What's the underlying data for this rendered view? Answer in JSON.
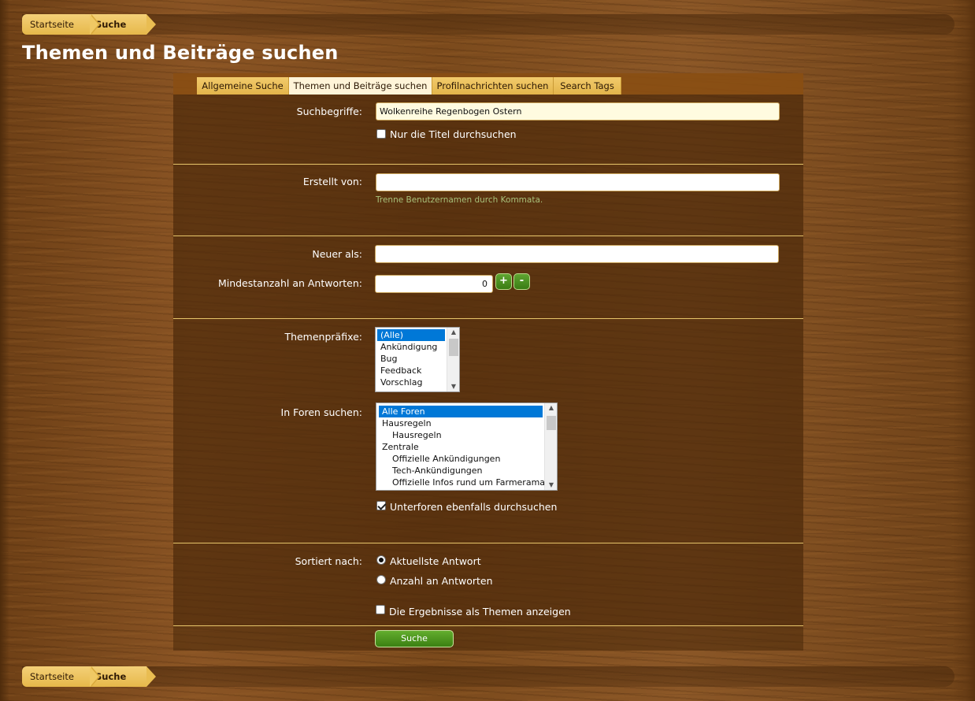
{
  "breadcrumb": {
    "home": "Startseite",
    "current": "Suche"
  },
  "page": {
    "title": "Themen und Beiträge suchen"
  },
  "tabs": [
    {
      "label": "Allgemeine Suche"
    },
    {
      "label": "Themen und Beiträge suchen"
    },
    {
      "label": "Profilnachrichten suchen"
    },
    {
      "label": "Search Tags"
    }
  ],
  "form": {
    "keywords_label": "Suchbegriffe:",
    "keywords_value": "Wolkenreihe Regenbogen Ostern",
    "titles_only_label": "Nur die Titel durchsuchen",
    "created_by_label": "Erstellt von:",
    "created_by_value": "",
    "created_by_hint": "Trenne Benutzernamen durch Kommata.",
    "newer_than_label": "Neuer als:",
    "newer_than_value": "",
    "min_replies_label": "Mindestanzahl an Antworten:",
    "min_replies_value": "0",
    "plus_label": "+",
    "minus_label": "-",
    "prefixes_label": "Themenpräfixe:",
    "prefixes": [
      "(Alle)",
      "Ankündigung",
      "Bug",
      "Feedback",
      "Vorschlag"
    ],
    "forums_label": "In Foren suchen:",
    "forums": [
      {
        "label": "Alle Foren",
        "indent": 0
      },
      {
        "label": "Hausregeln",
        "indent": 0
      },
      {
        "label": "Hausregeln",
        "indent": 1
      },
      {
        "label": "Zentrale",
        "indent": 0
      },
      {
        "label": "Offizielle Ankündigungen",
        "indent": 1
      },
      {
        "label": "Tech-Ankündigungen",
        "indent": 1
      },
      {
        "label": "Offizielle Infos rund um Farmerama",
        "indent": 1
      }
    ],
    "subforums_label": "Unterforen ebenfalls durchsuchen",
    "sort_label": "Sortiert nach:",
    "sort_recent": "Aktuellste Antwort",
    "sort_replies": "Anzahl an Antworten",
    "as_threads_label": "Die Ergebnisse als Themen anzeigen",
    "submit_label": "Suche"
  }
}
